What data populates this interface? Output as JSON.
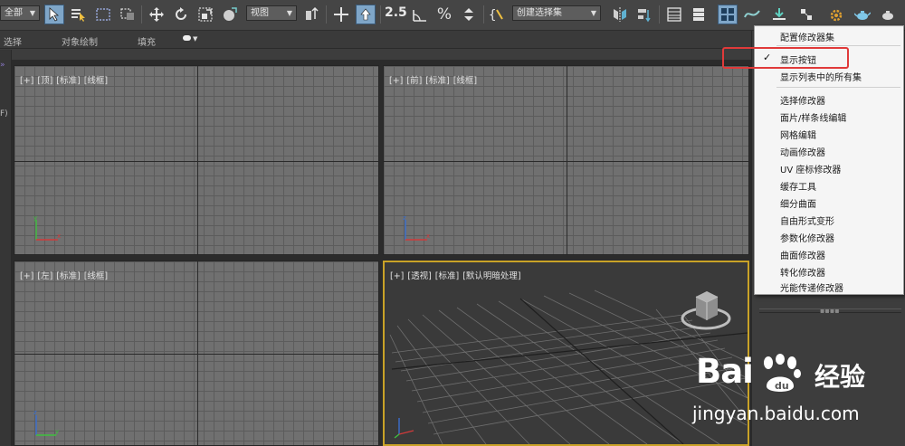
{
  "toolbar": {
    "selection_filter": "全部",
    "ref_coord_system": "视图",
    "named_selection_sets": "创建选择集",
    "snap_label": "2.5"
  },
  "ribbon": {
    "tabs": [
      "选择",
      "对象绘制",
      "填充"
    ]
  },
  "left_strip": {
    "label_top": "»",
    "label_mid": "F)"
  },
  "viewports": [
    {
      "labels": [
        "[+]",
        "[顶]",
        "[标准]",
        "[线框]"
      ]
    },
    {
      "labels": [
        "[+]",
        "[前]",
        "[标准]",
        "[线框]"
      ]
    },
    {
      "labels": [
        "[+]",
        "[左]",
        "[标准]",
        "[线框]"
      ]
    },
    {
      "labels": [
        "[+]",
        "[透视]",
        "[标准]",
        "[默认明暗处理]"
      ]
    }
  ],
  "context_menu": {
    "items": [
      {
        "label": "配置修改器集",
        "checked": false
      },
      {
        "label": "显示按钮",
        "checked": true
      },
      {
        "label": "显示列表中的所有集",
        "checked": false
      },
      {
        "label": "选择修改器",
        "checked": false
      },
      {
        "label": "面片/样条线编辑",
        "checked": false
      },
      {
        "label": "网格编辑",
        "checked": false
      },
      {
        "label": "动画修改器",
        "checked": false
      },
      {
        "label": "UV 座标修改器",
        "checked": false
      },
      {
        "label": "缓存工具",
        "checked": false
      },
      {
        "label": "细分曲面",
        "checked": false
      },
      {
        "label": "自由形式变形",
        "checked": false
      },
      {
        "label": "参数化修改器",
        "checked": false
      },
      {
        "label": "曲面修改器",
        "checked": false
      },
      {
        "label": "转化修改器",
        "checked": false
      },
      {
        "label": "光能传递修改器",
        "checked": false
      }
    ],
    "check_glyph": "✓"
  },
  "watermark": {
    "brand": "Bai",
    "brand_suffix": "经验",
    "url": "jingyan.baidu.com"
  },
  "colors": {
    "highlight": "#e03a3a",
    "active_viewport": "#c9a227",
    "active_button": "#7fa6c8"
  }
}
